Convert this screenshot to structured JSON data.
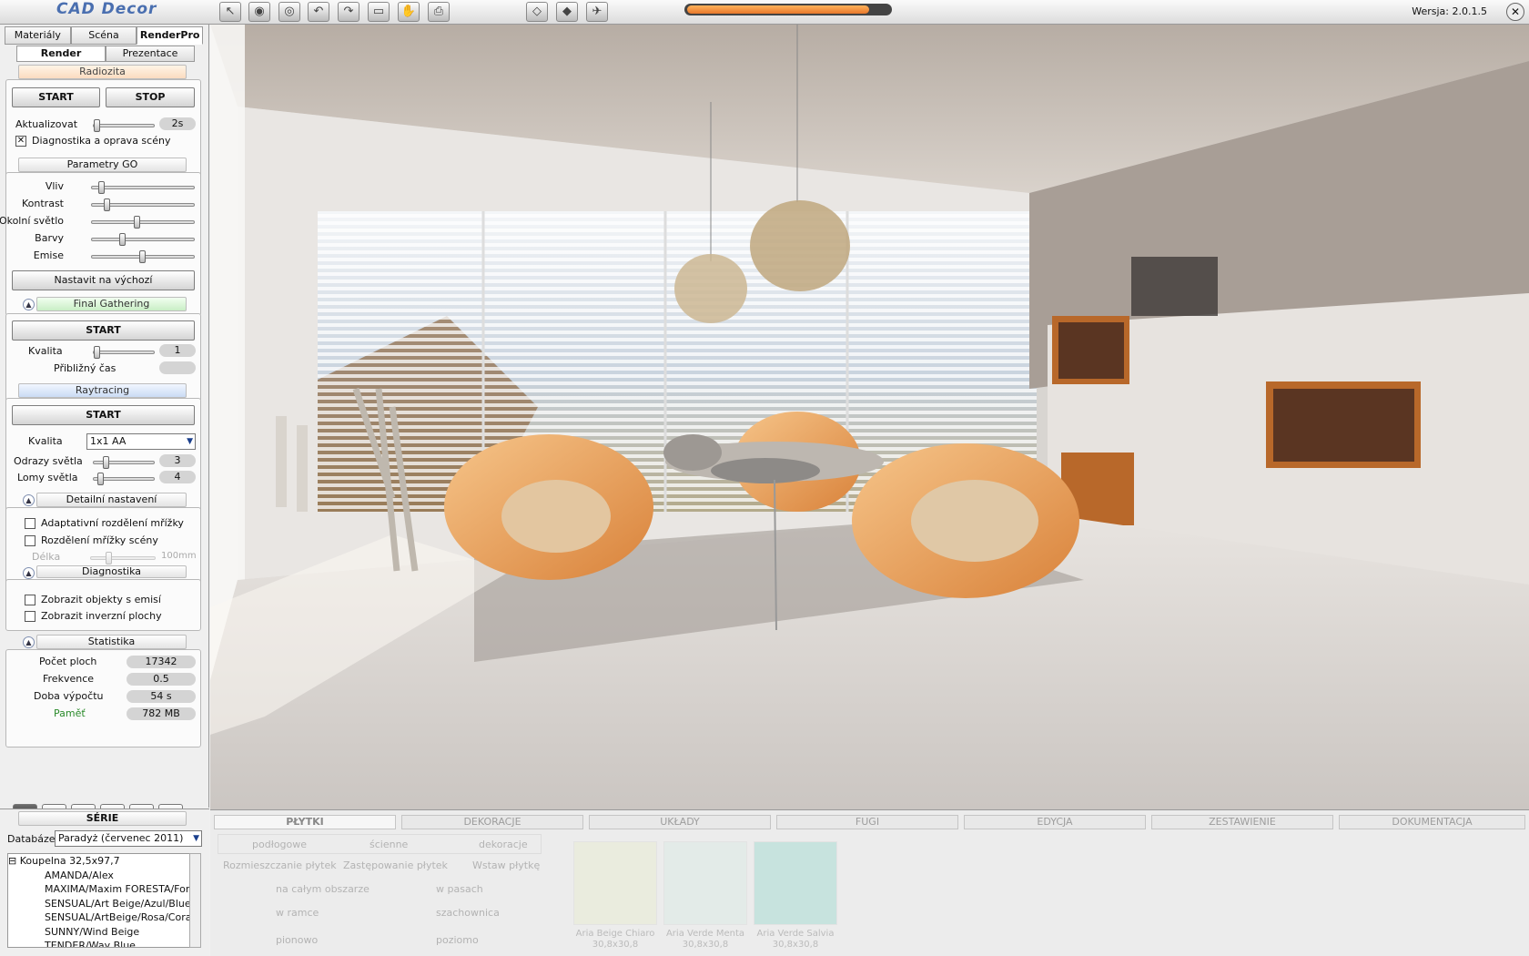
{
  "app": {
    "logo": "CAD Decor",
    "version": "Wersja: 2.0.1.5",
    "progress": 0.9
  },
  "toolbar": {
    "tools": [
      "pointer",
      "eye",
      "eye-alt",
      "undo",
      "redo",
      "frame",
      "hand",
      "print"
    ],
    "views": [
      "cube-wire",
      "cube-solid",
      "bird"
    ]
  },
  "tabs": {
    "main": [
      "Materiály",
      "Scéna",
      "RenderPro"
    ],
    "main_active": "RenderPro",
    "sub": [
      "Render",
      "Prezentace"
    ],
    "sub_active": "Render"
  },
  "radiozita": {
    "title": "Radiozita",
    "start": "START",
    "stop": "STOP",
    "update_label": "Aktualizovat",
    "update_value": "2s",
    "diag_label": "Diagnostika a oprava scény",
    "diag_checked": true
  },
  "go": {
    "title": "Parametry GO",
    "sliders": [
      {
        "label": "Vliv",
        "level": 0.1
      },
      {
        "label": "Kontrast",
        "level": 0.15
      },
      {
        "label": "Okolní světlo",
        "level": 0.45
      },
      {
        "label": "Barvy",
        "level": 0.3
      },
      {
        "label": "Emise",
        "level": 0.5
      }
    ],
    "reset": "Nastavit na výchozí"
  },
  "fg": {
    "title": "Final Gathering",
    "start": "START",
    "quality_label": "Kvalita",
    "quality_value": "1",
    "time_label": "Přibližný čas",
    "time_value": ""
  },
  "rt": {
    "title": "Raytracing",
    "start": "START",
    "quality_label": "Kvalita",
    "quality_value": "1x1 AA",
    "refl_label": "Odrazy světla",
    "refl_value": "3",
    "refr_label": "Lomy světla",
    "refr_value": "4"
  },
  "detail": {
    "title": "Detailní nastavení",
    "adaptive": "Adaptativní rozdělení mřížky",
    "split": "Rozdělení mřížky scény",
    "length_label": "Délka",
    "length_value": "100mm"
  },
  "diagnostics": {
    "title": "Diagnostika",
    "emit": "Zobrazit objekty s emisí",
    "inverse": "Zobrazit inverzní plochy"
  },
  "stats": {
    "title": "Statistika",
    "rows": [
      {
        "label": "Počet ploch",
        "value": "17342"
      },
      {
        "label": "Frekvence",
        "value": "0.5"
      },
      {
        "label": "Doba výpočtu",
        "value": "54 s"
      },
      {
        "label": "Paměť",
        "value": "782 MB"
      }
    ]
  },
  "series": {
    "title": "SÉRIE",
    "db_label": "Databáze",
    "db_value": "Paradyż (červenec 2011)",
    "tree_root": "Koupelna 32,5x97,7",
    "tree_items": [
      "AMANDA/Alex",
      "MAXIMA/Maxim FORESTA/For",
      "SENSUAL/Art Beige/Azul/Blue",
      "SENSUAL/ArtBeige/Rosa/Cora",
      "SUNNY/Wind Beige",
      "TENDER/Way Blue"
    ]
  },
  "bottom": {
    "tabs": [
      "PŁYTKI",
      "DEKORACJE",
      "UKŁADY",
      "FUGI",
      "EDYCJA",
      "ZESTAWIENIE",
      "DOKUMENTACJA"
    ],
    "active_tab": "PŁYTKI",
    "modes": [
      "podłogowe",
      "ścienne",
      "dekoracje"
    ],
    "subtabs": [
      "Rozmieszczanie płytek",
      "Zastępowanie płytek",
      "Wstaw płytkę"
    ],
    "options": [
      "na całym obszarze",
      "w pasach",
      "w ramce",
      "szachownica",
      "pionowo",
      "poziomo"
    ],
    "tiles": [
      {
        "name": "Aria Beige Chiaro",
        "size": "30,8x30,8",
        "color": "#e9edd4"
      },
      {
        "name": "Aria Verde Menta",
        "size": "30,8x30,8",
        "color": "#dcebe6"
      },
      {
        "name": "Aria Verde Salvia",
        "size": "30,8x30,8",
        "color": "#a9ddd4"
      }
    ]
  }
}
